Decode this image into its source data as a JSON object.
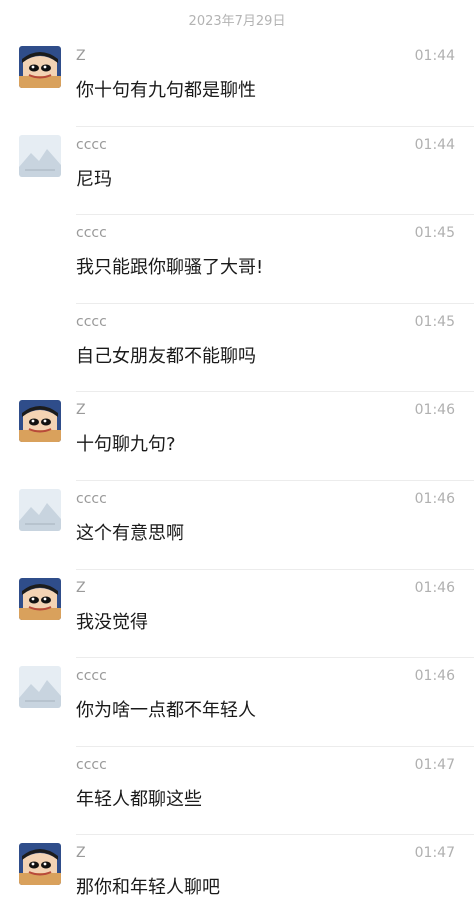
{
  "date_header": "2023年7月29日",
  "messages": [
    {
      "sender": "Z",
      "time": "01:44",
      "text": "你十句有九句都是聊性",
      "avatar": "cartoon-boy-icon"
    },
    {
      "sender": "cccc",
      "time": "01:44",
      "text": "尼玛",
      "avatar": "landscape-placeholder-icon"
    },
    {
      "sender": "cccc",
      "time": "01:45",
      "text": "我只能跟你聊骚了大哥!",
      "avatar": ""
    },
    {
      "sender": "cccc",
      "time": "01:45",
      "text": "自己女朋友都不能聊吗",
      "avatar": ""
    },
    {
      "sender": "Z",
      "time": "01:46",
      "text": "十句聊九句?",
      "avatar": "cartoon-boy-icon"
    },
    {
      "sender": "cccc",
      "time": "01:46",
      "text": "这个有意思啊",
      "avatar": "landscape-placeholder-icon"
    },
    {
      "sender": "Z",
      "time": "01:46",
      "text": "我没觉得",
      "avatar": "cartoon-boy-icon"
    },
    {
      "sender": "cccc",
      "time": "01:46",
      "text": "你为啥一点都不年轻人",
      "avatar": "landscape-placeholder-icon"
    },
    {
      "sender": "cccc",
      "time": "01:47",
      "text": "年轻人都聊这些",
      "avatar": ""
    },
    {
      "sender": "Z",
      "time": "01:47",
      "text": "那你和年轻人聊吧",
      "avatar": "cartoon-boy-icon"
    }
  ]
}
